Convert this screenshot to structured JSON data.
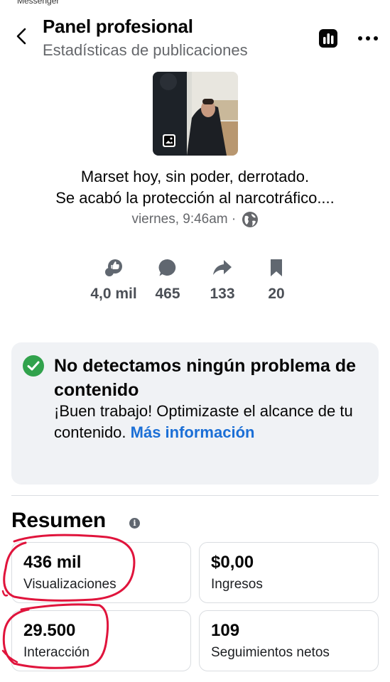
{
  "status": {
    "fragment": "Messenger"
  },
  "header": {
    "title": "Panel profesional",
    "subtitle": "Estadísticas de publicaciones"
  },
  "icons": {
    "back": "chevron-left-icon",
    "stats": "bar-chart-icon",
    "more": "more-dots-icon",
    "thumbnail_badge": "photo-icon",
    "globe": "globe-icon",
    "reactions": "thumbs-up-icon",
    "comments": "comment-bubble-icon",
    "shares": "share-arrow-icon",
    "saves": "bookmark-icon",
    "status_ok": "checkmark-circle-icon",
    "info": "info-icon"
  },
  "post": {
    "title_line1": "Marset hoy, sin poder, derrotado.",
    "title_line2": "Se acabó la protección al narcotráfico....",
    "meta": "viernes, 9:46am ·"
  },
  "metrics": [
    {
      "name": "reactions",
      "value": "4,0 mil"
    },
    {
      "name": "comments",
      "value": "465"
    },
    {
      "name": "shares",
      "value": "133"
    },
    {
      "name": "saves",
      "value": "20"
    }
  ],
  "notice": {
    "title": "No detectamos ningún problema de contenido",
    "body": "¡Buen trabajo! Optimizaste el alcance de tu contenido. ",
    "link": "Más información"
  },
  "summary": {
    "title": "Resumen",
    "info_glyph": "i",
    "cards": [
      {
        "value": "436 mil",
        "label": "Visualizaciones"
      },
      {
        "value": "$0,00",
        "label": "Ingresos"
      },
      {
        "value": "29.500",
        "label": "Interacción"
      },
      {
        "value": "109",
        "label": "Seguimientos netos"
      }
    ]
  },
  "colors": {
    "accent_link": "#1b6fd6",
    "success_green": "#31a24c",
    "card_border": "#dadde1",
    "notice_bg": "#f0f2f5",
    "annotation_red": "#e0143c"
  }
}
